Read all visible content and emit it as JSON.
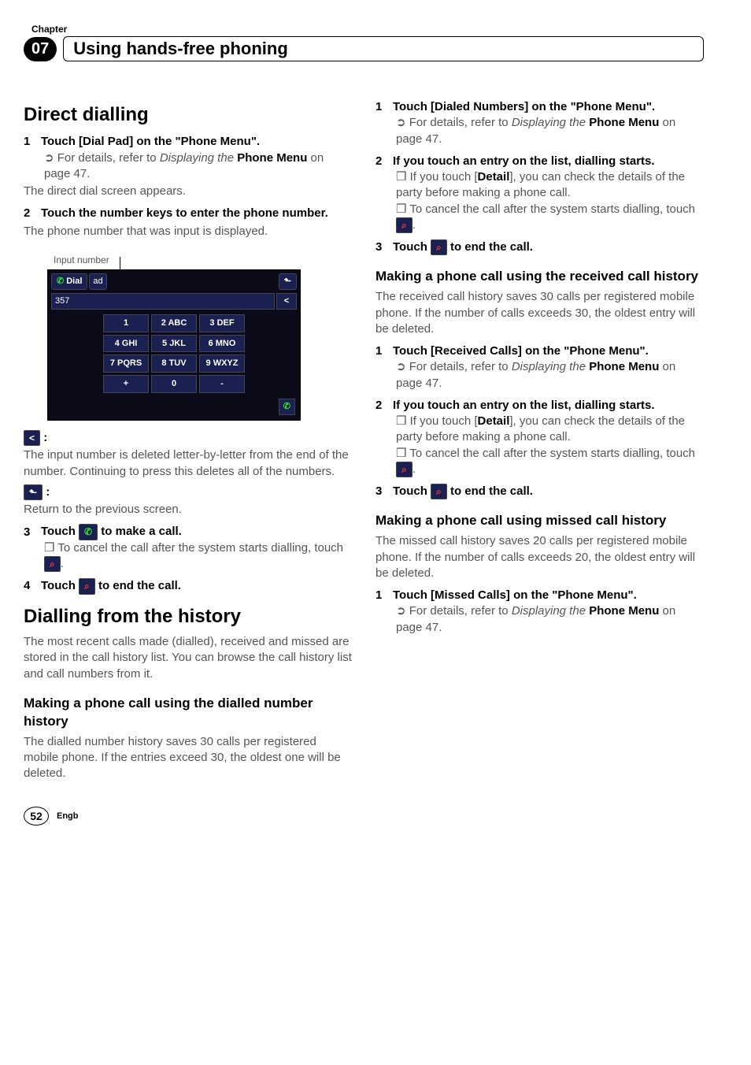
{
  "chapter": {
    "label": "Chapter",
    "number": "07",
    "title": "Using hands-free phoning"
  },
  "left": {
    "h1_direct": "Direct dialling",
    "s1": "Touch [Dial Pad] on the \"Phone Menu\".",
    "s1a_pre": "For details, refer to ",
    "s1a_it": "Displaying the ",
    "s1a_b": "Phone Menu",
    "s1a_post": " on page 47.",
    "s1_body": "The direct dial screen appears.",
    "s2": "Touch the number keys to enter the phone number.",
    "s2_body": "The phone number that was input is displayed.",
    "caption": "Input number",
    "del_label": ":",
    "del_body": "The input number is deleted letter-by-letter from the end of the number. Continuing to press this deletes all of the numbers.",
    "back_label": ":",
    "back_body": "Return to the previous screen.",
    "s3": "Touch ",
    "s3_after": " to make a call.",
    "s3a": "To cancel the call after the system starts dialling, touch ",
    "s4": "Touch ",
    "s4_after": " to end the call.",
    "h1_history": "Dialling from the history",
    "history_intro": "The most recent calls made (dialled), received and missed are stored in the call history list. You can browse the call history list and call numbers from it.",
    "h2_dialled": "Making a phone call using the dialled number history",
    "dialled_body": "The dialled number history saves 30 calls per registered mobile phone. If the entries exceed 30, the oldest one will be deleted."
  },
  "right": {
    "r_s1": "Touch [Dialed Numbers] on the \"Phone Menu\".",
    "ref_pre": "For details, refer to ",
    "ref_it": "Displaying the ",
    "ref_b": "Phone Menu",
    "ref_post": " on page 47.",
    "r_s2": "If you touch an entry on the list, dialling starts.",
    "r_s2a_pre": "If you touch [",
    "r_s2a_b": "Detail",
    "r_s2a_post": "], you can check the details of the party before making a phone call.",
    "r_s2b": "To cancel the call after the system starts dialling, touch ",
    "r_s3": "Touch ",
    "r_s3_after": " to end the call.",
    "h2_received": "Making a phone call using the received call history",
    "received_body": "The received call history saves 30 calls per registered mobile phone. If the number of calls exceeds 30, the oldest entry will be deleted.",
    "rc_s1": "Touch [Received Calls] on the \"Phone Menu\".",
    "h2_missed": "Making a phone call using missed call history",
    "missed_body": "The missed call history saves 20 calls per registered mobile phone. If the number of calls exceeds 20, the oldest entry will be deleted.",
    "mc_s1": "Touch [Missed Calls] on the \"Phone Menu\"."
  },
  "dialpad": {
    "tab1": "Dial",
    "tab2": "ad",
    "number": "357",
    "keys": [
      "1",
      "2 ABC",
      "3 DEF",
      "4 GHI",
      "5 JKL",
      "6 MNO",
      "7 PQRS",
      "8 TUV",
      "9 WXYZ",
      "+",
      "0",
      "-"
    ]
  },
  "icons": {
    "back_arrow": "⬑",
    "delete": "<",
    "call": "✆",
    "hangup": "⌕"
  },
  "footer": {
    "page": "52",
    "lang": "Engb"
  }
}
